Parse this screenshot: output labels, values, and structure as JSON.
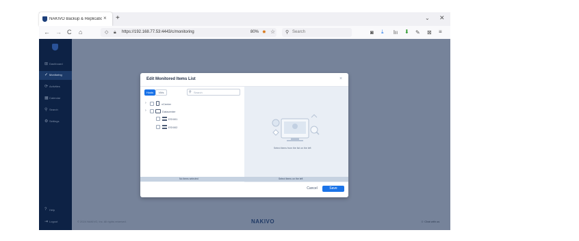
{
  "browser": {
    "tab_title": "NAKIVO Backup & Replication",
    "tab_close": "×",
    "new_tab": "+",
    "url": "https://192.168.77.53:4443/c/monitoring",
    "zoom": "80%",
    "search_placeholder": "Search"
  },
  "sidebar": {
    "items": [
      {
        "label": "Dashboard",
        "icon": "dashboard-icon",
        "glyph": "⊞"
      },
      {
        "label": "Monitoring",
        "icon": "monitoring-icon",
        "glyph": "✓"
      },
      {
        "label": "Activities",
        "icon": "activities-icon",
        "glyph": "⟳"
      },
      {
        "label": "Calendar",
        "icon": "calendar-icon",
        "glyph": "▦"
      },
      {
        "label": "Search",
        "icon": "search-icon",
        "glyph": "⚲"
      },
      {
        "label": "Settings",
        "icon": "settings-icon",
        "glyph": "⚙"
      }
    ],
    "active_index": 1,
    "bottom_items": [
      {
        "label": "Help",
        "glyph": "?"
      },
      {
        "label": "Logout",
        "glyph": "⇥"
      }
    ]
  },
  "footer": {
    "copyright": "© 2024 NAKIVO, Inc. All rights reserved.",
    "brand": "NAKIVO",
    "chat": "Chat with us"
  },
  "dialog": {
    "title": "Edit Monitored Items List",
    "close": "×",
    "filter_tabs": [
      "Hosts",
      "VMs"
    ],
    "search_placeholder": "Search",
    "tree": [
      {
        "label": "vCenter",
        "expand": "›",
        "icon": "server-icon"
      },
      {
        "label": "Datacenter",
        "expand": "›",
        "icon": "folder-icon"
      },
      {
        "label": "ESXi01",
        "icon": "host-icon"
      },
      {
        "label": "ESXi02",
        "icon": "host-icon"
      }
    ],
    "left_footer": "No items selected",
    "right_footer": "Select items on the left",
    "empty_state": "Select items from the list on the left",
    "cancel_label": "Cancel",
    "save_label": "Save"
  },
  "colors": {
    "sidebar_bg": "#0d2245",
    "overlay_bg": "#76839a",
    "accent": "#1a73e8"
  }
}
